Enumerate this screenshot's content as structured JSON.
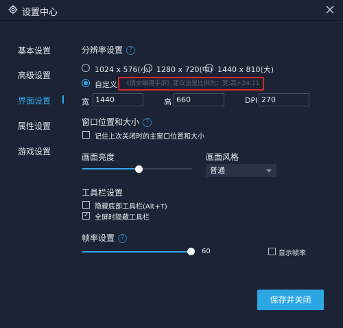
{
  "window": {
    "title": "设置中心",
    "icon": "gear-icon",
    "close_icon": "close-icon"
  },
  "sidebar": {
    "items": [
      {
        "label": "基本设置",
        "active": false
      },
      {
        "label": "高级设置",
        "active": false
      },
      {
        "label": "界面设置",
        "active": true
      },
      {
        "label": "属性设置",
        "active": false
      },
      {
        "label": "游戏设置",
        "active": false
      }
    ]
  },
  "resolution": {
    "title": "分辨率设置",
    "help": "?",
    "options": [
      {
        "label": "1024 x 576(小)",
        "checked": false
      },
      {
        "label": "1280 x 720(中)",
        "checked": false
      },
      {
        "label": "1440 x 810(大)",
        "checked": false
      },
      {
        "label": "自定义",
        "checked": true
      }
    ],
    "hint": "《倩女幽魂手游》建议设置比例为：宽:高=24:11",
    "width_label": "宽",
    "width_value": "1440",
    "height_label": "高",
    "height_value": "660",
    "dpi_label": "DPI",
    "dpi_value": "270"
  },
  "window_position": {
    "title": "窗口位置和大小",
    "help": "?",
    "remember_label": "记住上次关闭时的主窗口位置和大小",
    "remember_checked": false
  },
  "brightness": {
    "title": "画面亮度",
    "level": 0.5
  },
  "style": {
    "title": "画面风格",
    "selected": "普通"
  },
  "toolbar": {
    "title": "工具栏设置",
    "hide_bottom_label": "隐藏底部工具栏(Alt+T)",
    "hide_bottom_checked": false,
    "fullscreen_hide_label": "全屏时隐藏工具栏",
    "fullscreen_hide_checked": true
  },
  "framerate": {
    "title": "帧率设置",
    "help": "?",
    "value": "60",
    "level": 1.0,
    "show_fps_label": "显示帧率",
    "show_fps_checked": false
  },
  "actions": {
    "save_close_label": "保存并关闭"
  },
  "colors": {
    "background": "#1b2334",
    "accent": "#2fa8ea",
    "highlight_box": "#e0262a",
    "button": "#2aa7e3"
  }
}
